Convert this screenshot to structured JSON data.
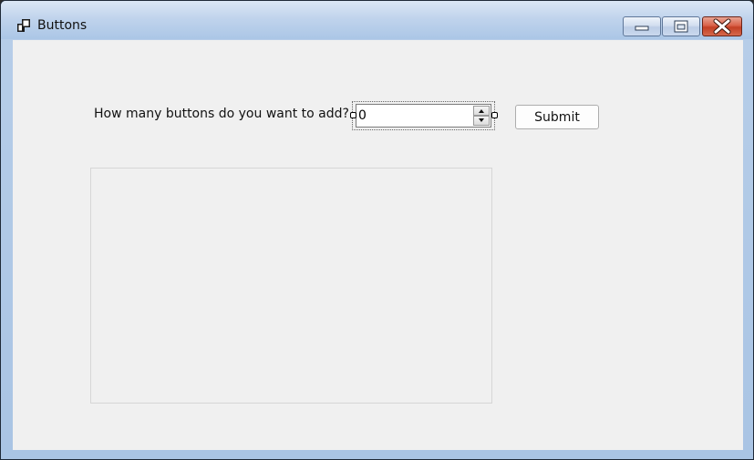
{
  "window": {
    "title": "Buttons",
    "app_icon": "form-icon"
  },
  "title_controls": {
    "minimize": "minimize-icon",
    "maximize": "maximize-icon",
    "close": "close-icon"
  },
  "form": {
    "prompt_label": "How many buttons do you want to add?",
    "count_value": "0",
    "submit_label": "Submit"
  },
  "colors": {
    "client_background": "#f0f0f0",
    "close_button": "#c94a31"
  }
}
